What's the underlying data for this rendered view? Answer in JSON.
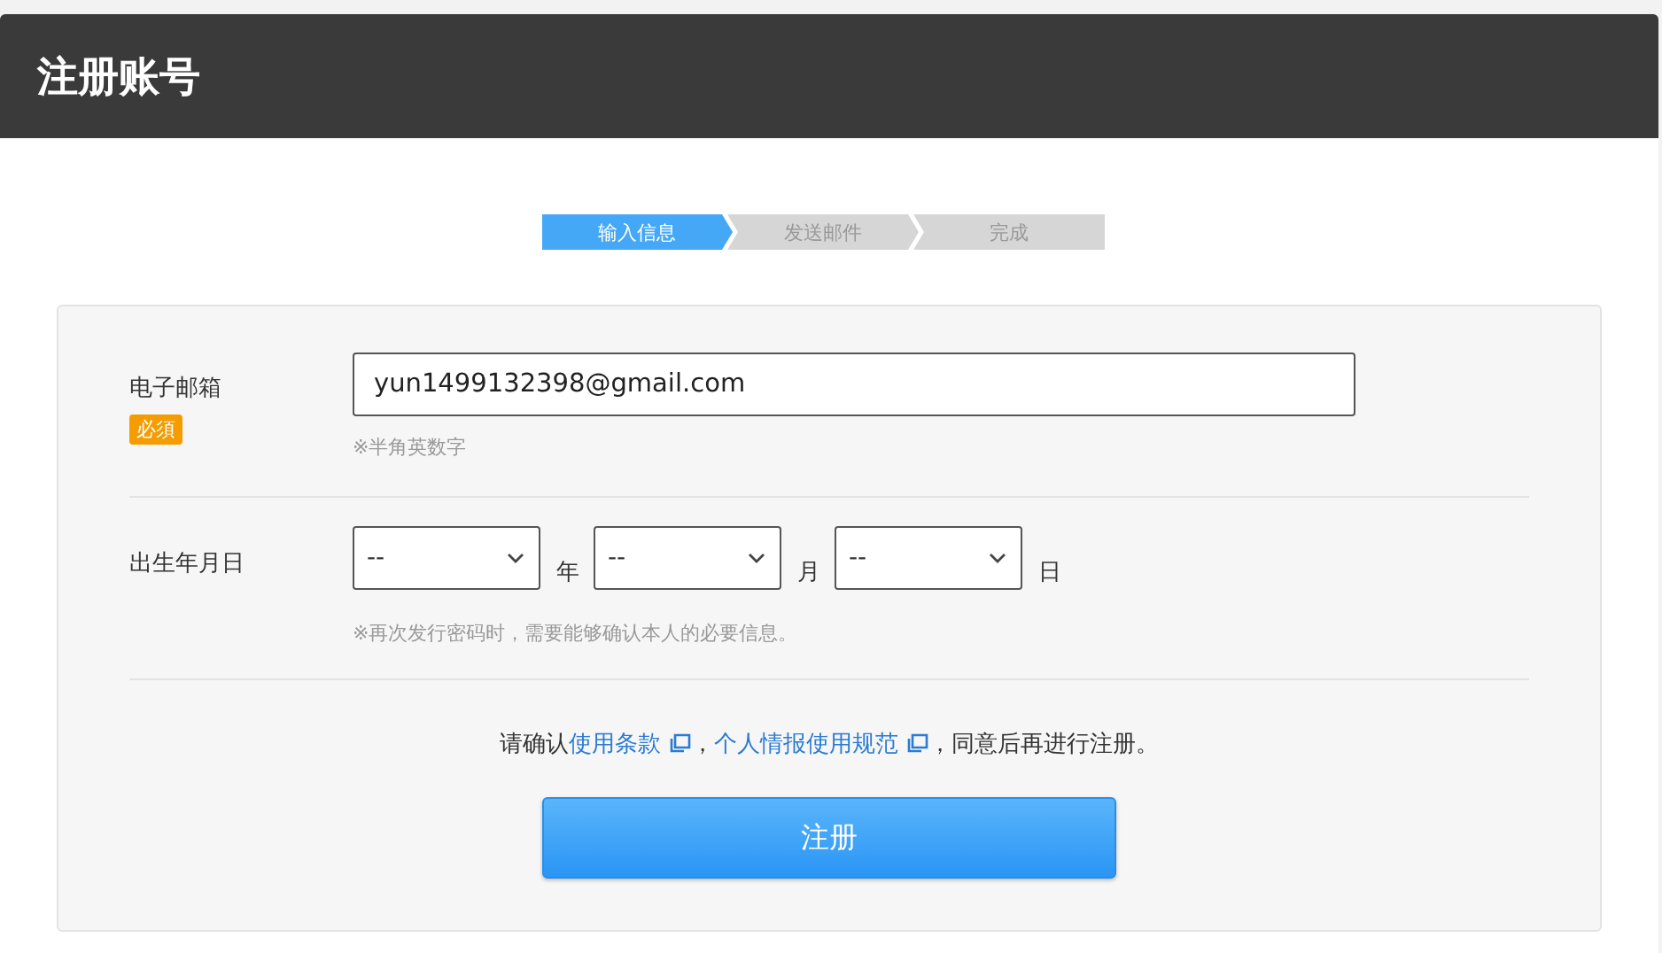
{
  "header": {
    "title": "注册账号"
  },
  "steps": [
    {
      "label": "输入信息",
      "selected": true
    },
    {
      "label": "发送邮件",
      "selected": false
    },
    {
      "label": "完成",
      "selected": false
    }
  ],
  "form": {
    "email": {
      "label": "电子邮箱",
      "required_badge": "必須",
      "value": "yun1499132398@gmail.com",
      "hint": "※半角英数字"
    },
    "birthday": {
      "label": "出生年月日",
      "selects": [
        {
          "value": "--",
          "unit": "年"
        },
        {
          "value": "--",
          "unit": "月"
        },
        {
          "value": "--",
          "unit": "日"
        }
      ],
      "hint": "※再次发行密码时，需要能够确认本人的必要信息。"
    },
    "consent": {
      "lead": "请确认",
      "links": [
        {
          "text": "使用条款",
          "after": "，"
        },
        {
          "text": "个人情报使用规范",
          "after": "，同意后再进行注册。"
        }
      ]
    },
    "submit": "注册"
  }
}
